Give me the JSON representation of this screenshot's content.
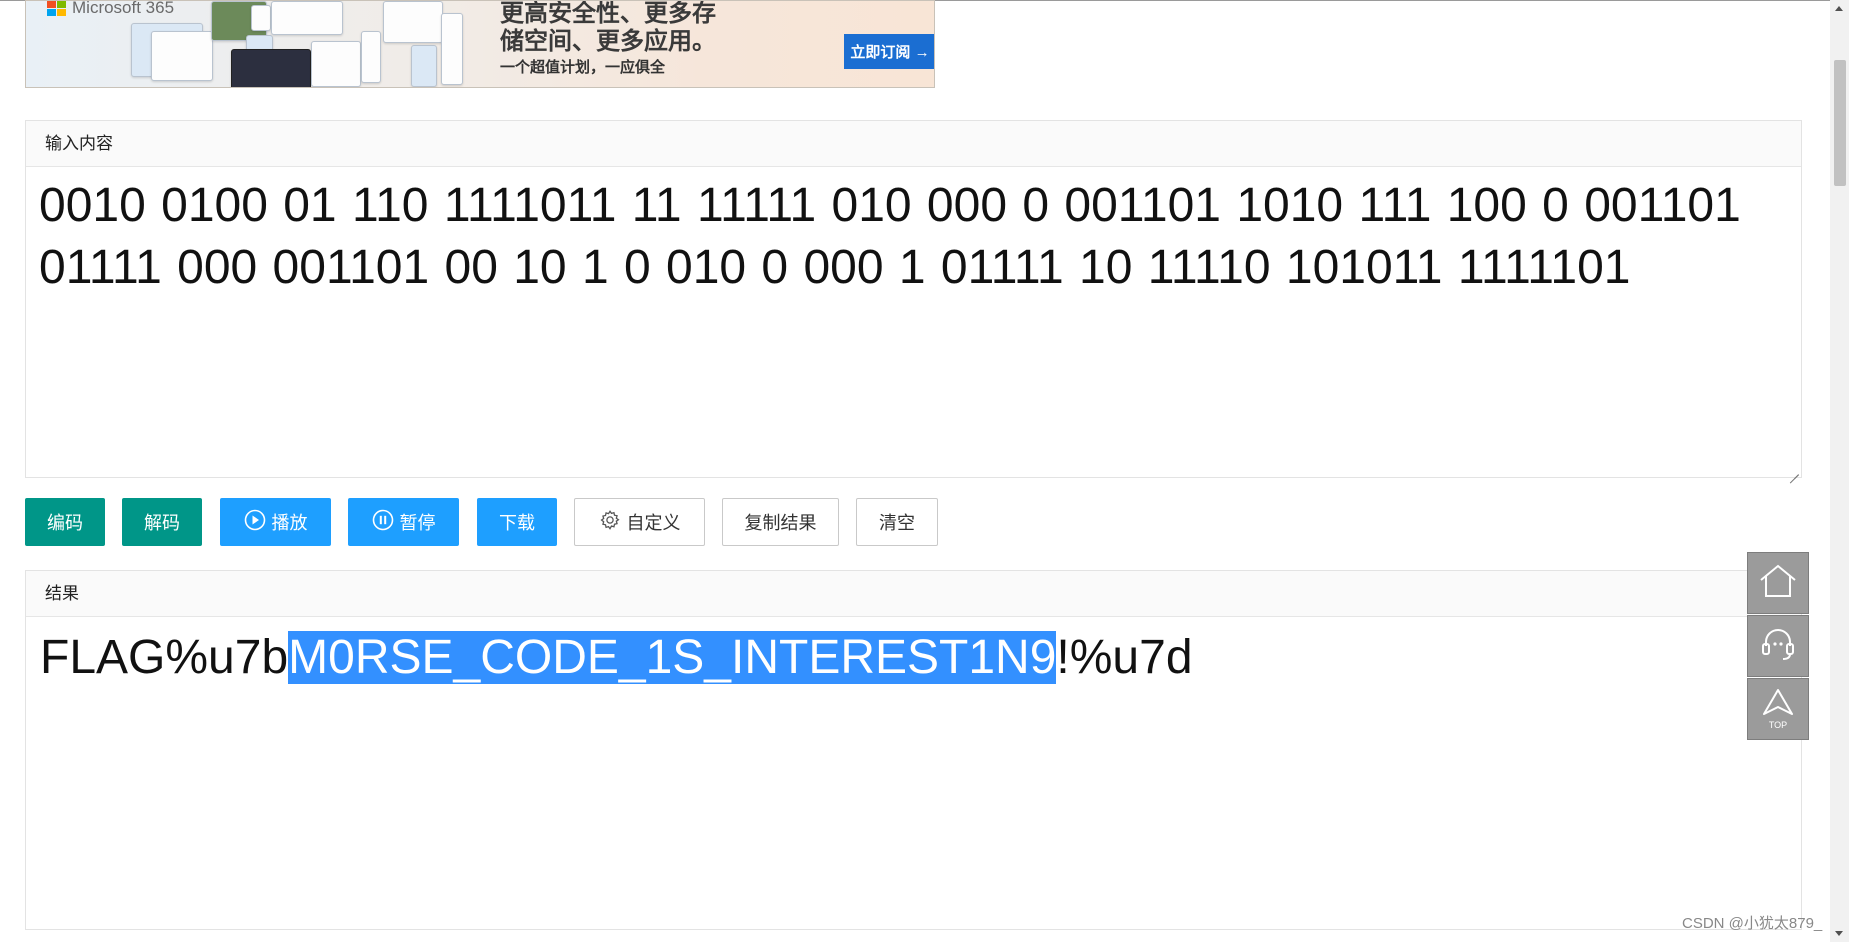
{
  "banner": {
    "brand": "Microsoft 365",
    "headline_line1": "更高安全性、更多存",
    "headline_line2": "储空间、更多应用。",
    "subline": "一个超值计划，一应俱全",
    "cta_label": "立即订阅 →",
    "logo_colors": [
      "#f25022",
      "#7fba00",
      "#00a4ef",
      "#ffb900"
    ]
  },
  "input_panel": {
    "title": "输入内容",
    "value": "0010 0100 01 110 1111011 11 11111 010 000 0 001101 1010 111 100 0 001101 01111 000 001101 00 10 1 0 010 0 000 1 01111 10 11110 101011 1111101"
  },
  "toolbar": {
    "encode": "编码",
    "decode": "解码",
    "play": "播放",
    "pause": "暂停",
    "download": "下载",
    "custom": "自定义",
    "copy_result": "复制结果",
    "clear": "清空"
  },
  "result_panel": {
    "title": "结果",
    "prefix": "FLAG%u7b",
    "selected": "M0RSE_CODE_1S_INTEREST1N9",
    "suffix": "!%u7d"
  },
  "side_tools": {
    "top_label": "TOP"
  },
  "watermark": "CSDN @小犹太879_",
  "colors": {
    "teal": "#009688",
    "blue": "#1e9fff",
    "selection": "#3390ff",
    "cta": "#1b6ed2"
  }
}
